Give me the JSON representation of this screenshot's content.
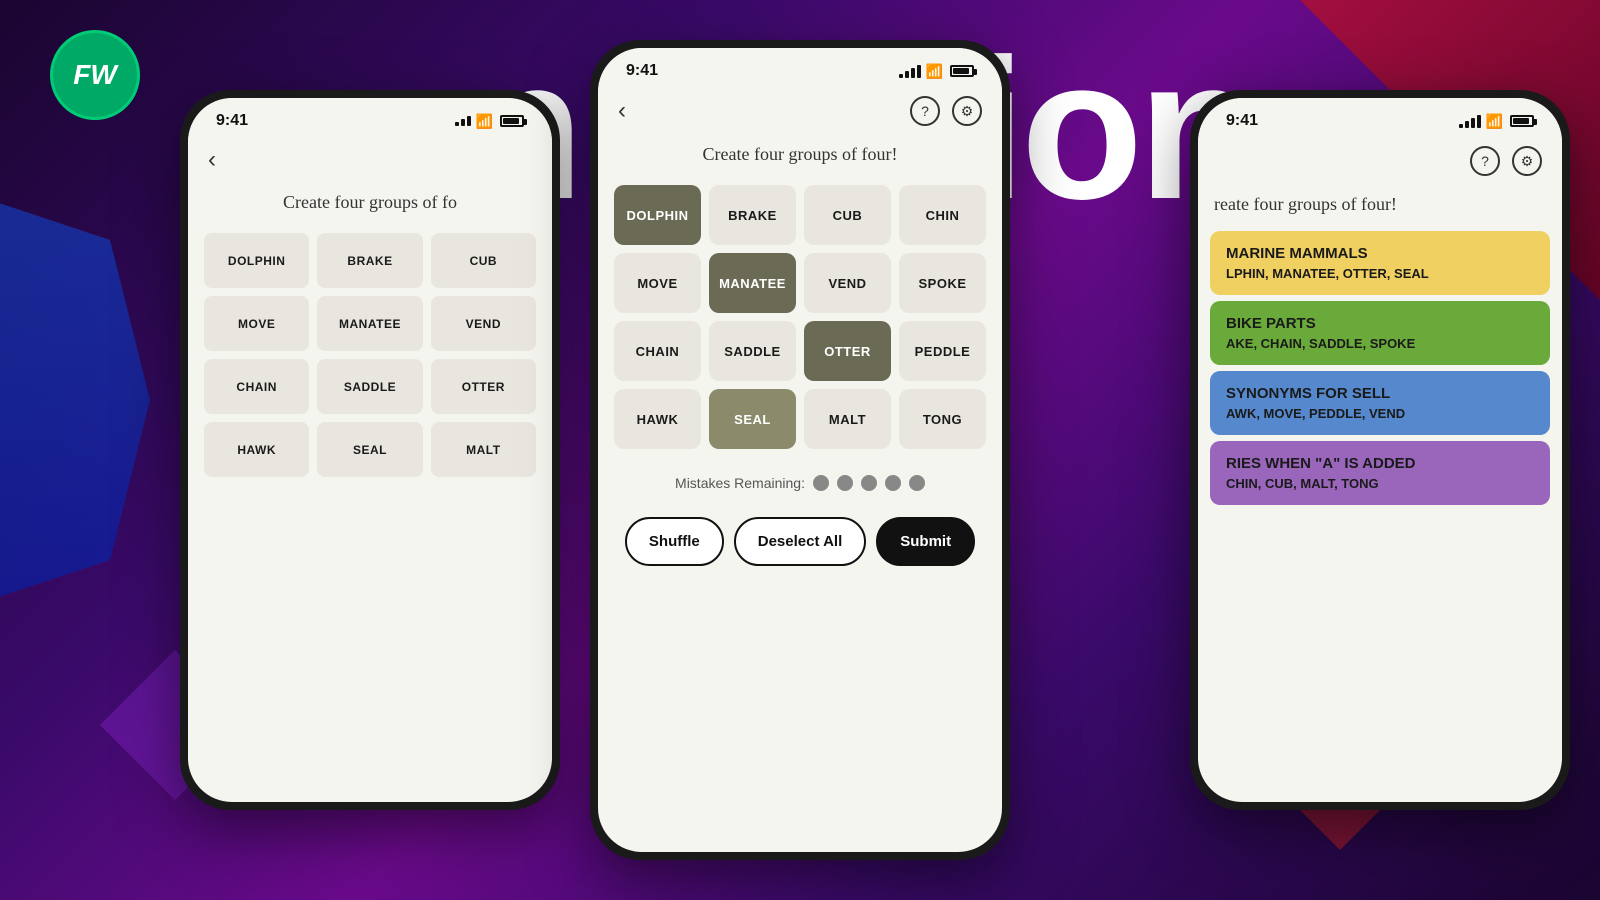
{
  "background": {
    "color": "#2a0a4a"
  },
  "logo": {
    "text": "FW",
    "bg_color": "#00aa66"
  },
  "title": {
    "text": "Connections"
  },
  "center_phone": {
    "status": {
      "time": "9:41",
      "signal": "▲▲▲",
      "wifi": "wifi",
      "battery": "battery"
    },
    "heading": "Create four groups of four!",
    "grid": [
      {
        "word": "DOLPHIN",
        "selected": "dark"
      },
      {
        "word": "BRAKE",
        "selected": "none"
      },
      {
        "word": "CUB",
        "selected": "none"
      },
      {
        "word": "CHIN",
        "selected": "none"
      },
      {
        "word": "MOVE",
        "selected": "none"
      },
      {
        "word": "MANATEE",
        "selected": "dark"
      },
      {
        "word": "VEND",
        "selected": "none"
      },
      {
        "word": "SPOKE",
        "selected": "none"
      },
      {
        "word": "CHAIN",
        "selected": "none"
      },
      {
        "word": "SADDLE",
        "selected": "none"
      },
      {
        "word": "OTTER",
        "selected": "dark"
      },
      {
        "word": "PEDDLE",
        "selected": "none"
      },
      {
        "word": "HAWK",
        "selected": "none"
      },
      {
        "word": "SEAL",
        "selected": "medium"
      },
      {
        "word": "MALT",
        "selected": "none"
      },
      {
        "word": "TONG",
        "selected": "none"
      }
    ],
    "mistakes_label": "Mistakes Remaining:",
    "dots": 5,
    "buttons": {
      "shuffle": "Shuffle",
      "deselect": "Deselect All",
      "submit": "Submit"
    }
  },
  "left_phone": {
    "status": {
      "time": "9:41"
    },
    "heading": "Create four groups of fo",
    "grid": [
      {
        "word": "DOLPHIN"
      },
      {
        "word": "BRAKE"
      },
      {
        "word": "CUB"
      },
      {
        "word": "MOVE"
      },
      {
        "word": "MANATEE"
      },
      {
        "word": "VEND"
      },
      {
        "word": "CHAIN"
      },
      {
        "word": "SADDLE"
      },
      {
        "word": "OTTER"
      },
      {
        "word": "HAWK"
      },
      {
        "word": "SEAL"
      },
      {
        "word": "MALT"
      }
    ]
  },
  "right_phone": {
    "heading": "reate four groups of four!",
    "categories": [
      {
        "title": "MARINE MAMMALS",
        "words": "LPHIN, MANATEE, OTTER, SEAL",
        "color": "yellow"
      },
      {
        "title": "BIKE PARTS",
        "words": "AKE, CHAIN, SADDLE, SPOKE",
        "color": "green"
      },
      {
        "title": "SYNONYMS FOR SELL",
        "words": "AWK, MOVE, PEDDLE, VEND",
        "color": "blue"
      },
      {
        "title": "RIES WHEN \"A\" IS ADDED",
        "words": "CHIN, CUB, MALT, TONG",
        "color": "purple"
      }
    ]
  }
}
